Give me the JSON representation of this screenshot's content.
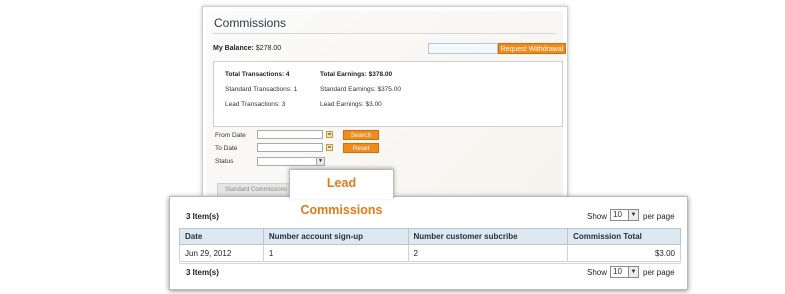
{
  "panel": {
    "title": "Commissions",
    "balance_label": "My Balance:",
    "balance_value": "$278.00",
    "withdraw_button": "Request Withdrawal",
    "stats": {
      "total_transactions": "Total Transactions: 4",
      "standard_transactions": "Standard Transactions: 1",
      "lead_transactions": "Lead Transactions: 3",
      "total_earnings": "Total Earnings: $378.00",
      "standard_earnings": "Standard Earnings: $375.00",
      "lead_earnings": "Lead Earnings: $3.00"
    },
    "filters": {
      "from_date_label": "From Date",
      "to_date_label": "To Date",
      "status_label": "Status",
      "search_button": "Search",
      "reset_button": "Reset"
    },
    "tabs": {
      "standard": "Standard Commissions",
      "lead": "Lead Commissions"
    }
  },
  "grid": {
    "count_top": "3 Item(s)",
    "count_bottom": "3 Item(s)",
    "show_label": "Show",
    "per_page_label": "per page",
    "per_page_value": "10",
    "columns": [
      "Date",
      "Number account sign-up",
      "Number customer subcribe",
      "Commission Total"
    ],
    "rows": [
      [
        "Jun 29, 2012",
        "1",
        "2",
        "$3.00"
      ]
    ]
  },
  "colors": {
    "accent": "#f08a1c",
    "tab_text": "#e37a17",
    "header_bg": "#dde8f1"
  }
}
